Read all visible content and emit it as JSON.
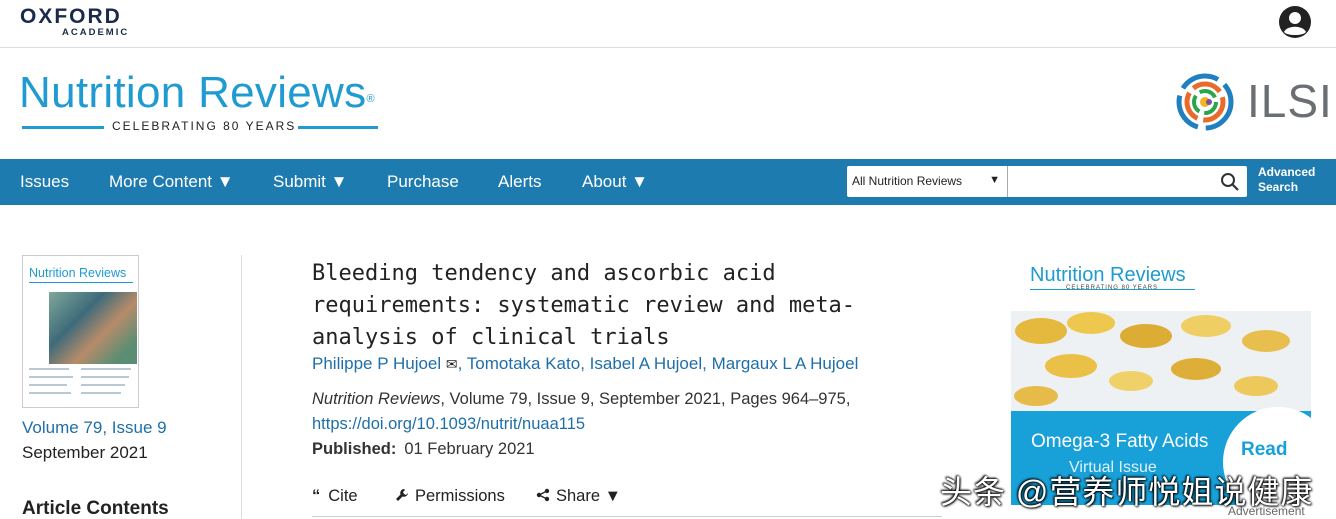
{
  "header": {
    "publisher_line1": "OXFORD",
    "publisher_line2": "ACADEMIC",
    "user_icon": "account-circle-icon"
  },
  "masthead": {
    "journal_title": "Nutrition Reviews",
    "journal_mark": "®",
    "journal_tagline": "CELEBRATING 80 YEARS",
    "partner_logo": "ILSI",
    "brand_color": "#1f9bd1"
  },
  "nav": {
    "bg_color": "#1e7bb0",
    "items": [
      {
        "label": "Issues"
      },
      {
        "label": "More Content ▼"
      },
      {
        "label": "Submit ▼"
      },
      {
        "label": "Purchase"
      },
      {
        "label": "Alerts"
      },
      {
        "label": "About ▼"
      }
    ],
    "search_scope": "All Nutrition Reviews",
    "search_scope_arrow": "▼",
    "search_value": "",
    "search_icon": "search-icon",
    "advanced_search_line1": "Advanced",
    "advanced_search_line2": "Search"
  },
  "sidebar": {
    "cover_title": "Nutrition Reviews",
    "issue_link": "Volume 79, Issue 9",
    "issue_date": "September 2021",
    "contents_heading": "Article Contents"
  },
  "article": {
    "title": "Bleeding tendency and ascorbic acid requirements: systematic review and meta-analysis of clinical trials",
    "authors": [
      {
        "name": "Philippe P Hujoel"
      },
      {
        "name": "Tomotaka Kato"
      },
      {
        "name": "Isabel A Hujoel"
      },
      {
        "name": "Margaux L A Hujoel"
      }
    ],
    "author_email_icon": "✉",
    "journal_name": "Nutrition Reviews",
    "citation_rest": ", Volume 79, Issue 9, September 2021, Pages 964–975,",
    "doi": "https://doi.org/10.1093/nutrit/nuaa115",
    "published_label": "Published:",
    "published_date": "01 February 2021",
    "tools": {
      "cite_icon": "“",
      "cite": "Cite",
      "permissions_icon": "wrench-icon",
      "permissions": "Permissions",
      "share_icon": "share-icon",
      "share": "Share ▼"
    }
  },
  "ad": {
    "journal_title": "Nutrition Reviews",
    "journal_tagline": "CELEBRATING 80 YEARS",
    "headline": "Omega-3 Fatty Acids",
    "subhead": "Virtual Issue",
    "cta": "Read",
    "label": "Advertisement",
    "accent_color": "#18a0d8"
  },
  "watermark": "头条 @营养师悦姐说健康"
}
